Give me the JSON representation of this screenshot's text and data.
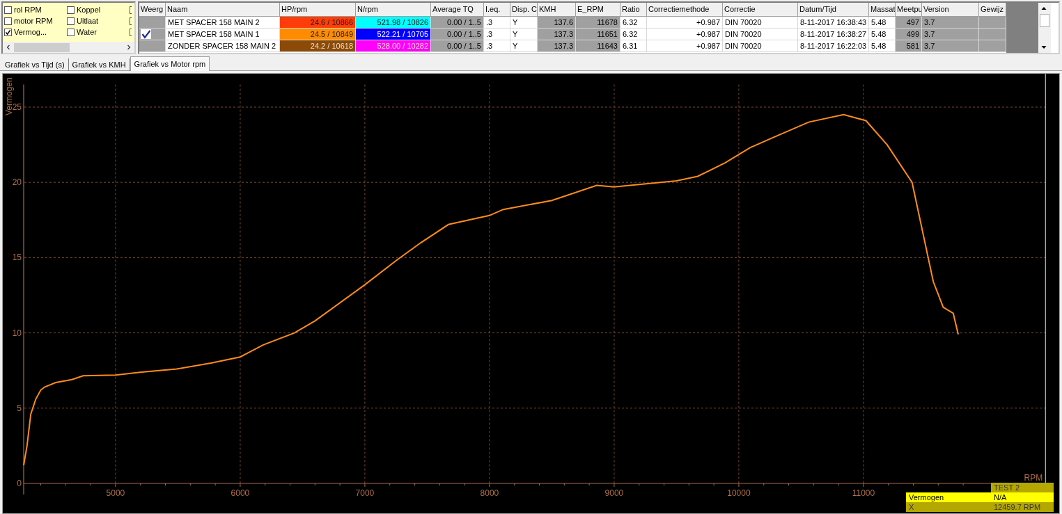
{
  "channels": [
    {
      "label": "rol RPM",
      "checked": false
    },
    {
      "label": "motor RPM",
      "checked": false
    },
    {
      "label": "Vermog...",
      "checked": true
    },
    {
      "label": "Koppel",
      "checked": false
    },
    {
      "label": "Uitlaat",
      "checked": false
    },
    {
      "label": "Water",
      "checked": false
    }
  ],
  "table": {
    "columns": [
      "Weerg",
      "Naam",
      "HP/rpm",
      "N/rpm",
      "Average TQ",
      "I.eq.",
      "Disp. C",
      "KMH",
      "E_RPM",
      "Ratio",
      "Correctiemethode",
      "Correctie",
      "Datum/Tijd",
      "Massat",
      "Meetpu",
      "Version",
      "Gewijz"
    ],
    "rows": [
      {
        "cells": [
          {
            "checked": false
          },
          "MET SPACER 158 MAIN 2",
          {
            "text": "24.6 / 10866",
            "color": "#ff3d0a"
          },
          {
            "text": "521.98 / 10826",
            "color": "#00ffff"
          },
          "0.00 / 1..5",
          ".3",
          "Y",
          "137.6",
          "11678",
          "6.32",
          "+0.987",
          "DIN 70020",
          "8-11-2017 16:38:43",
          "5.48",
          "497",
          "3.7",
          ""
        ]
      },
      {
        "cells": [
          {
            "checked": true
          },
          "MET SPACER 158 MAIN 1",
          {
            "text": "24.5 / 10849",
            "color": "#ff8c00"
          },
          {
            "text": "522.21 / 10705",
            "color": "#0000ff"
          },
          "0.00 / 1..5",
          ".3",
          "Y",
          "137.3",
          "11651",
          "6.32",
          "+0.987",
          "DIN 70020",
          "8-11-2017 16:38:27",
          "5.48",
          "499",
          "3.7",
          ""
        ]
      },
      {
        "cells": [
          {
            "checked": false
          },
          "ZONDER SPACER 158 MAIN 2",
          {
            "text": "24.2 / 10618",
            "color": "#8b4a08"
          },
          {
            "text": "528.00 / 10282",
            "color": "#ff00ff"
          },
          "0.00 / 1..5",
          ".3",
          "Y",
          "137.3",
          "11643",
          "6.31",
          "+0.987",
          "DIN 70020",
          "8-11-2017 16:22:03",
          "5.48",
          "581",
          "3.7",
          ""
        ]
      }
    ]
  },
  "tabs": [
    {
      "label": "Grafiek vs Tijd (s)",
      "selected": false
    },
    {
      "label": "Grafiek vs KMH",
      "selected": false
    },
    {
      "label": "Grafiek vs Motor rpm",
      "selected": true
    }
  ],
  "chart": {
    "chart_data": {
      "type": "line",
      "xlabel": "RPM",
      "ylabel": "Vermogen",
      "grid": true,
      "xlim": [
        4263,
        12460
      ],
      "ylim": [
        0,
        26.5
      ],
      "xticks": [
        5000,
        6000,
        7000,
        8000,
        9000,
        10000,
        11000
      ],
      "yticks": [
        0,
        5,
        10,
        15,
        20,
        25
      ],
      "x": [
        4263,
        4290,
        4320,
        4360,
        4400,
        4430,
        4520,
        4650,
        4740,
        5000,
        5210,
        5490,
        5765,
        6000,
        6185,
        6435,
        6600,
        7000,
        7250,
        7450,
        7670,
        8000,
        8110,
        8500,
        8860,
        9000,
        9500,
        9670,
        9890,
        10090,
        10280,
        10560,
        10840,
        11020,
        11190,
        11390,
        11560,
        11640,
        11720,
        11760
      ],
      "series": [
        {
          "name": "Vermogen",
          "color": "#ff8c1a",
          "values": [
            1.2,
            2.5,
            4.6,
            5.6,
            6.2,
            6.4,
            6.7,
            6.9,
            7.15,
            7.2,
            7.4,
            7.6,
            8.0,
            8.4,
            9.2,
            10.0,
            10.8,
            13.2,
            14.8,
            16.0,
            17.2,
            17.8,
            18.2,
            18.8,
            19.8,
            19.7,
            20.1,
            20.4,
            21.3,
            22.3,
            23.0,
            24.0,
            24.5,
            24.1,
            22.5,
            20.0,
            13.4,
            11.7,
            11.3,
            9.9
          ]
        }
      ]
    },
    "cursor": {
      "title": "TEST  2",
      "rows": [
        {
          "value": "N/A",
          "kind": "series"
        },
        {
          "label": "X",
          "value": "12459.7 RPM",
          "kind": "axis"
        }
      ]
    }
  }
}
